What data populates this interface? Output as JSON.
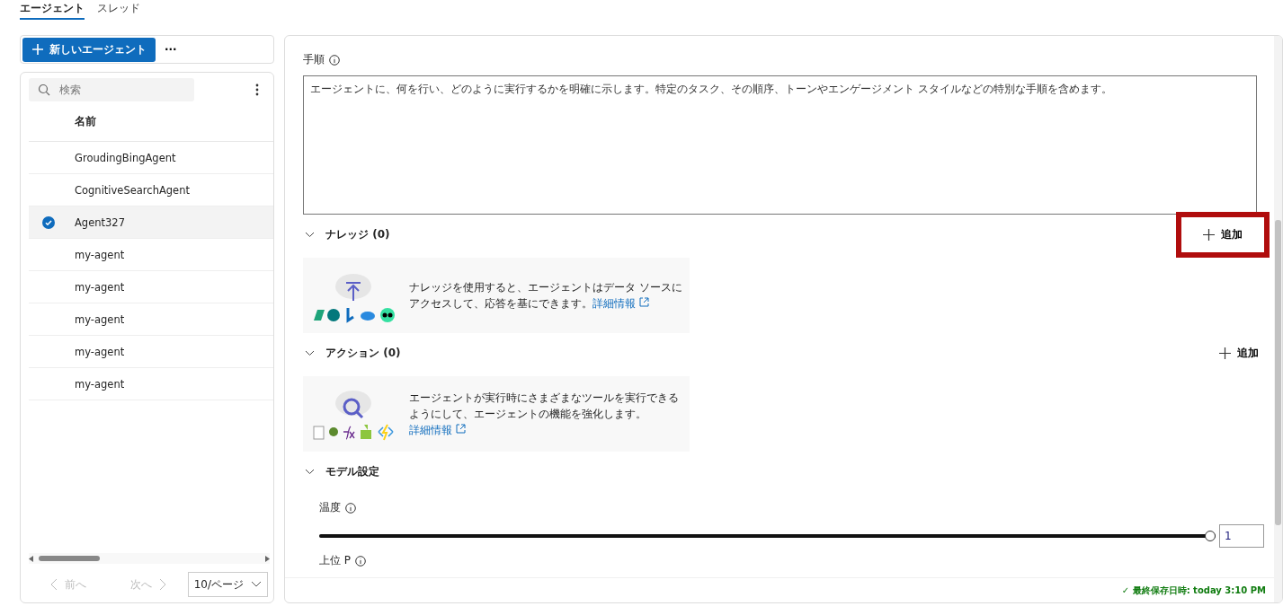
{
  "tabs": [
    {
      "label": "エージェント",
      "selected": true
    },
    {
      "label": "スレッド",
      "selected": false
    }
  ],
  "sidebar": {
    "new_button": "新しいエージェント",
    "more": "···",
    "search": {
      "placeholder": "検索"
    },
    "column": "名前",
    "items": [
      {
        "name": "GroudingBingAgent",
        "selected": false
      },
      {
        "name": "CognitiveSearchAgent",
        "selected": false
      },
      {
        "name": "Agent327",
        "selected": true
      },
      {
        "name": "my-agent",
        "selected": false
      },
      {
        "name": "my-agent",
        "selected": false
      },
      {
        "name": "my-agent",
        "selected": false
      },
      {
        "name": "my-agent",
        "selected": false
      },
      {
        "name": "my-agent",
        "selected": false
      }
    ],
    "pagination": {
      "prev": {
        "label": "前へ",
        "disabled": true
      },
      "next": {
        "label": "次へ",
        "disabled": true
      },
      "page_size": "10/ページ"
    }
  },
  "instructions": {
    "label": "手順",
    "value": "エージェントに、何を行い、どのように実行するかを明確に示します。特定のタスク、その順序、トーンやエンゲージメント スタイルなどの特別な手順を含めます。"
  },
  "sections": [
    {
      "kind": "knowledge",
      "title": "ナレッジ",
      "count": "(0)",
      "add": "追加",
      "highlighted": true,
      "text": "ナレッジを使用すると、エージェントはデータ ソースにアクセスして、応答を基にできます。",
      "link": "詳細情報"
    },
    {
      "kind": "action",
      "title": "アクション",
      "count": "(0)",
      "add": "追加",
      "highlighted": false,
      "text": "エージェントが実行時にさまざまなツールを実行できるようにして、エージェントの機能を強化します。",
      "link": "詳細情報"
    }
  ],
  "model": {
    "title": "モデル設定",
    "temperature": {
      "label": "温度",
      "level": 1,
      "value": "1"
    },
    "top_p": {
      "label": "上位 P"
    }
  },
  "status": "✓ 最終保存日時: today 3:10 PM"
}
